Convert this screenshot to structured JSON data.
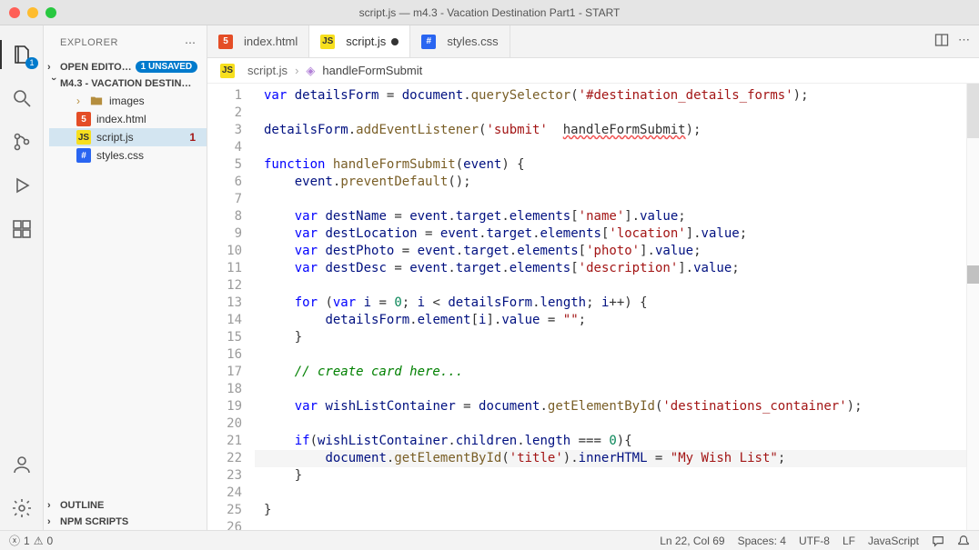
{
  "window": {
    "title": "script.js — m4.3 - Vacation Destination Part1 - START"
  },
  "activity": {
    "explorer_badge": "1"
  },
  "sidebar": {
    "title": "EXPLORER",
    "open_editors": {
      "label": "OPEN EDITO…",
      "badge": "1 UNSAVED"
    },
    "folder": {
      "label": "M4.3 - VACATION DESTIN…"
    },
    "items": [
      {
        "name": "images",
        "type": "folder"
      },
      {
        "name": "index.html",
        "type": "html"
      },
      {
        "name": "script.js",
        "type": "js",
        "trailing": "1",
        "active": true
      },
      {
        "name": "styles.css",
        "type": "css"
      }
    ],
    "outline": "OUTLINE",
    "npm": "NPM SCRIPTS"
  },
  "tabs": [
    {
      "label": "index.html",
      "type": "html"
    },
    {
      "label": "script.js",
      "type": "js",
      "active": true,
      "dirty": true
    },
    {
      "label": "styles.css",
      "type": "css"
    }
  ],
  "breadcrumb": {
    "first": "script.js",
    "second": "handleFormSubmit"
  },
  "code": {
    "lines": [
      {
        "n": 1,
        "html": "<span class='kw'>var</span> <span class='var2'>detailsForm</span> = <span class='var2'>document</span>.<span class='fn'>querySelector</span>(<span class='str'>'#destination_details_forms'</span>);"
      },
      {
        "n": 2,
        "html": ""
      },
      {
        "n": 3,
        "html": "<span class='var2'>detailsForm</span>.<span class='fn'>addEventListener</span>(<span class='str'>'submit'</span>  <span class='err'>handleFormSubmit</span>);"
      },
      {
        "n": 4,
        "html": ""
      },
      {
        "n": 5,
        "html": "<span class='kw'>function</span> <span class='fn'>handleFormSubmit</span>(<span class='var2'>event</span>) {"
      },
      {
        "n": 6,
        "html": "    <span class='var2'>event</span>.<span class='fn'>preventDefault</span>();"
      },
      {
        "n": 7,
        "html": ""
      },
      {
        "n": 8,
        "html": "    <span class='kw'>var</span> <span class='var2'>destName</span> = <span class='var2'>event</span>.<span class='prop'>target</span>.<span class='prop'>elements</span>[<span class='str'>'name'</span>].<span class='prop'>value</span>;"
      },
      {
        "n": 9,
        "html": "    <span class='kw'>var</span> <span class='var2'>destLocation</span> = <span class='var2'>event</span>.<span class='prop'>target</span>.<span class='prop'>elements</span>[<span class='str'>'location'</span>].<span class='prop'>value</span>;"
      },
      {
        "n": 10,
        "html": "    <span class='kw'>var</span> <span class='var2'>destPhoto</span> = <span class='var2'>event</span>.<span class='prop'>target</span>.<span class='prop'>elements</span>[<span class='str'>'photo'</span>].<span class='prop'>value</span>;"
      },
      {
        "n": 11,
        "html": "    <span class='kw'>var</span> <span class='var2'>destDesc</span> = <span class='var2'>event</span>.<span class='prop'>target</span>.<span class='prop'>elements</span>[<span class='str'>'description'</span>].<span class='prop'>value</span>;"
      },
      {
        "n": 12,
        "html": ""
      },
      {
        "n": 13,
        "html": "    <span class='kw'>for</span> (<span class='kw'>var</span> <span class='var2'>i</span> = <span class='num'>0</span>; <span class='var2'>i</span> &lt; <span class='var2'>detailsForm</span>.<span class='prop'>length</span>; <span class='var2'>i</span>++) {"
      },
      {
        "n": 14,
        "html": "        <span class='var2'>detailsForm</span>.<span class='prop'>element</span>[<span class='var2'>i</span>].<span class='prop'>value</span> = <span class='str'>\"\"</span>;"
      },
      {
        "n": 15,
        "html": "    }"
      },
      {
        "n": 16,
        "html": ""
      },
      {
        "n": 17,
        "html": "    <span class='cm'>// create card here...</span>"
      },
      {
        "n": 18,
        "html": ""
      },
      {
        "n": 19,
        "html": "    <span class='kw'>var</span> <span class='var2'>wishListContainer</span> = <span class='var2'>document</span>.<span class='fn'>getElementById</span>(<span class='str'>'destinations_container'</span>);"
      },
      {
        "n": 20,
        "html": ""
      },
      {
        "n": 21,
        "html": "    <span class='kw'>if</span>(<span class='var2'>wishListContainer</span>.<span class='prop'>children</span>.<span class='prop'>length</span> === <span class='num'>0</span>){"
      },
      {
        "n": 22,
        "html": "        <span class='var2'>document</span>.<span class='fn'>getElementById</span>(<span class='str'>'title'</span>).<span class='prop'>innerHTML</span> = <span class='str'>\"My Wish List\"</span>;",
        "hl": true
      },
      {
        "n": 23,
        "html": "    }"
      },
      {
        "n": 24,
        "html": ""
      },
      {
        "n": 25,
        "html": "}"
      },
      {
        "n": 26,
        "html": ""
      }
    ]
  },
  "status": {
    "errors": "1",
    "warnings": "0",
    "cursor": "Ln 22, Col 69",
    "spaces": "Spaces: 4",
    "encoding": "UTF-8",
    "eol": "LF",
    "lang": "JavaScript"
  }
}
